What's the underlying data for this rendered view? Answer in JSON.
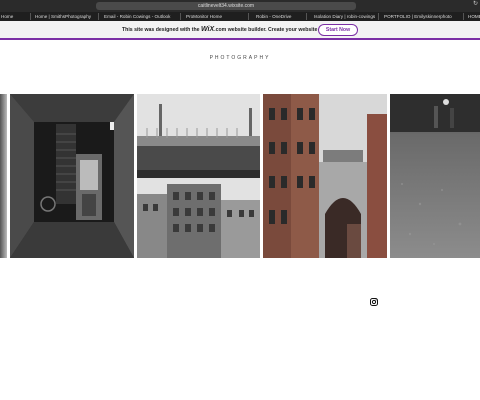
{
  "browser": {
    "url": "caitlinevelt34.wixsite.com",
    "bookmarks": [
      "Home",
      "Home | SmithsPhotography",
      "Email - Robin Cowings - Outlook",
      "ProMonitor Home",
      "Robin - OneDrive",
      "Isolation Diary | robin-cowings",
      "PORTFOLIO | Emilyskinnerphoto",
      "HOME"
    ]
  },
  "wix_banner": {
    "text_prefix": "This site was designed with the ",
    "brand": "WiX",
    "text_suffix": ".com website builder. Create your website today.",
    "button": "Start Now",
    "accent": "#7b2fa5"
  },
  "page": {
    "heading": "PHOTOGRAPHY"
  },
  "gallery": {
    "photos": [
      {
        "subject": "partial edge photo"
      },
      {
        "subject": "dark alley with stairs and phone box"
      },
      {
        "subject": "railway bridge over buildings"
      },
      {
        "subject": "red brick buildings with arch"
      },
      {
        "subject": "close-up street pavement"
      }
    ]
  },
  "social": {
    "icon": "instagram-icon"
  }
}
